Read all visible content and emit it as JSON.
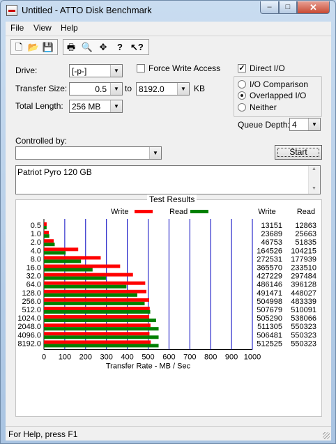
{
  "window": {
    "title": "Untitled - ATTO Disk Benchmark",
    "min": "–",
    "max": "□",
    "close": "✕"
  },
  "menu": {
    "file": "File",
    "view": "View",
    "help": "Help"
  },
  "toolbar": {
    "icons": [
      "new-icon",
      "open-icon",
      "save-icon",
      "print-icon",
      "print-preview-icon",
      "move-icon",
      "help-icon",
      "context-help-icon"
    ]
  },
  "form": {
    "drive_label": "Drive:",
    "drive_value": "[-p-]",
    "force_write_label": "Force Write Access",
    "force_write_checked": false,
    "direct_io_label": "Direct I/O",
    "direct_io_checked": true,
    "transfer_size_label": "Transfer Size:",
    "transfer_from": "0.5",
    "to_label": "to",
    "transfer_to": "8192.0",
    "kb_label": "KB",
    "total_length_label": "Total Length:",
    "total_length_value": "256 MB",
    "radio_io_comparison": "I/O Comparison",
    "radio_overlapped": "Overlapped I/O",
    "radio_neither": "Neither",
    "selected_mode": "Overlapped I/O",
    "queue_depth_label": "Queue Depth:",
    "queue_depth_value": "4",
    "controlled_by_label": "Controlled by:",
    "controlled_by_value": "",
    "start_button": "Start",
    "description": "Patriot Pyro 120 GB"
  },
  "results": {
    "group_title": "Test Results",
    "legend_write": "Write",
    "legend_read": "Read",
    "col_write": "Write",
    "col_read": "Read",
    "rows": [
      {
        "size": "0.5",
        "write": "13151",
        "read": "12863"
      },
      {
        "size": "1.0",
        "write": "23689",
        "read": "25663"
      },
      {
        "size": "2.0",
        "write": "46753",
        "read": "51835"
      },
      {
        "size": "4.0",
        "write": "164526",
        "read": "104215"
      },
      {
        "size": "8.0",
        "write": "272531",
        "read": "177939"
      },
      {
        "size": "16.0",
        "write": "365570",
        "read": "233510"
      },
      {
        "size": "32.0",
        "write": "427229",
        "read": "297484"
      },
      {
        "size": "64.0",
        "write": "486146",
        "read": "396128"
      },
      {
        "size": "128.0",
        "write": "491471",
        "read": "448027"
      },
      {
        "size": "256.0",
        "write": "504998",
        "read": "483339"
      },
      {
        "size": "512.0",
        "write": "507679",
        "read": "510091"
      },
      {
        "size": "1024.0",
        "write": "505290",
        "read": "538066"
      },
      {
        "size": "2048.0",
        "write": "511305",
        "read": "550323"
      },
      {
        "size": "4096.0",
        "write": "506481",
        "read": "550323"
      },
      {
        "size": "8192.0",
        "write": "512525",
        "read": "550323"
      }
    ]
  },
  "chart_data": {
    "type": "bar",
    "orientation": "horizontal",
    "categories": [
      "0.5",
      "1.0",
      "2.0",
      "4.0",
      "8.0",
      "16.0",
      "32.0",
      "64.0",
      "128.0",
      "256.0",
      "512.0",
      "1024.0",
      "2048.0",
      "4096.0",
      "8192.0"
    ],
    "series": [
      {
        "name": "Write",
        "color": "#ff0000",
        "values": [
          13.2,
          23.7,
          46.8,
          164.5,
          272.5,
          365.6,
          427.2,
          486.1,
          491.5,
          505.0,
          507.7,
          505.3,
          511.3,
          506.5,
          512.5
        ]
      },
      {
        "name": "Read",
        "color": "#008000",
        "values": [
          12.9,
          25.7,
          51.8,
          104.2,
          177.9,
          233.5,
          297.5,
          396.1,
          448.0,
          483.3,
          510.1,
          538.1,
          550.3,
          550.3,
          550.3
        ]
      }
    ],
    "xlabel": "Transfer Rate - MB / Sec",
    "xlim": [
      0,
      1000
    ],
    "xticks": [
      "0",
      "100",
      "200",
      "300",
      "400",
      "500",
      "600",
      "700",
      "800",
      "900",
      "1000"
    ],
    "grid": true,
    "legend_position": "top"
  },
  "statusbar": {
    "text": "For Help, press F1"
  }
}
